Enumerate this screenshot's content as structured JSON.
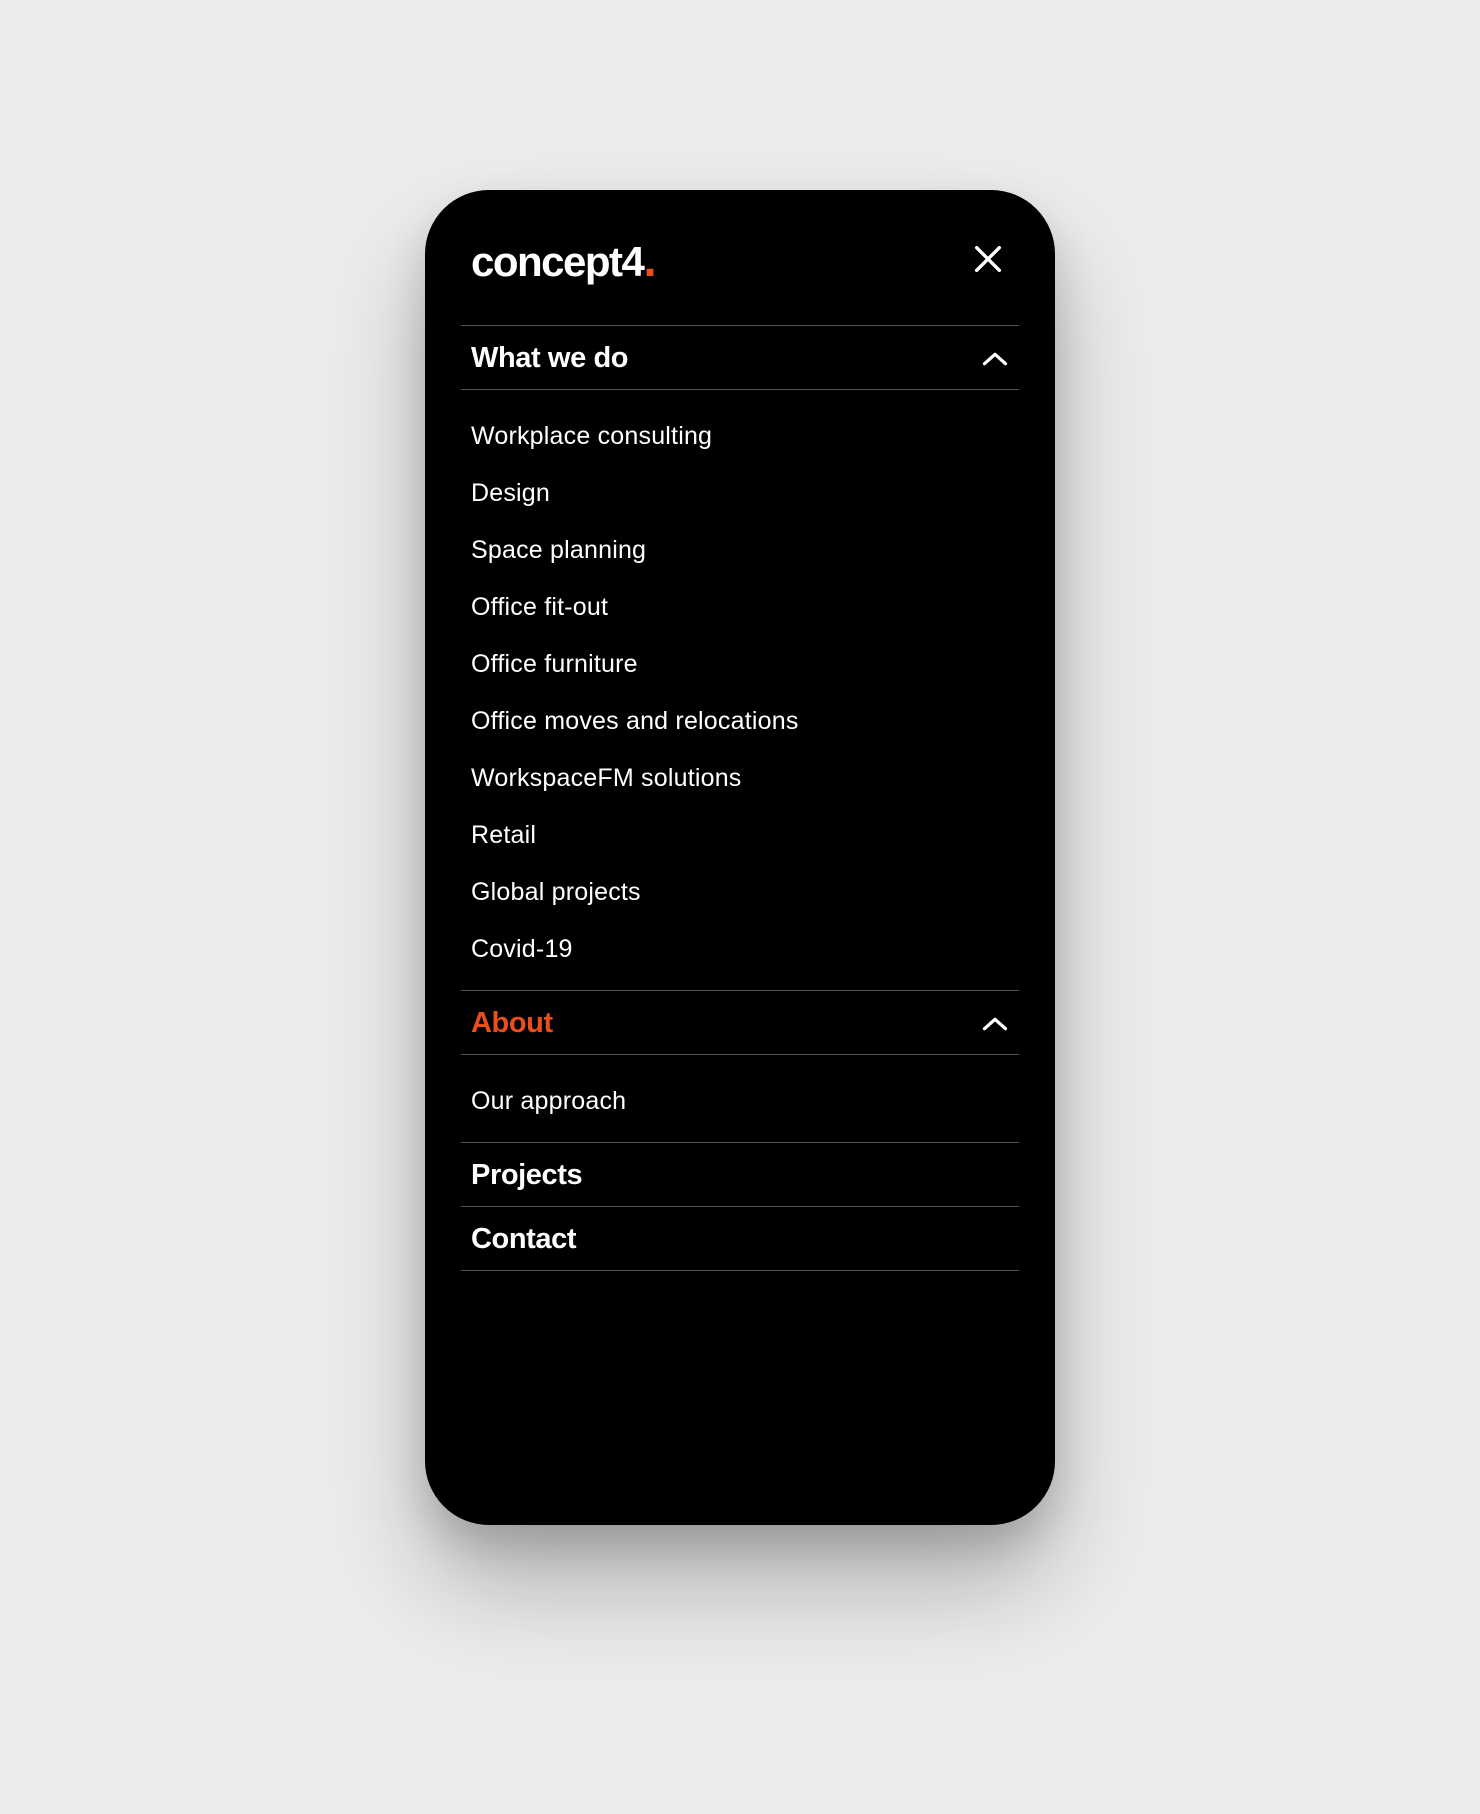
{
  "logo": {
    "text": "concept4",
    "dot": "."
  },
  "menu": {
    "sections": [
      {
        "label": "What we do",
        "expanded": true,
        "active": false,
        "items": [
          "Workplace consulting",
          "Design",
          "Space planning",
          "Office fit-out",
          "Office furniture",
          "Office moves and relocations",
          "WorkspaceFM solutions",
          "Retail",
          "Global projects",
          "Covid-19"
        ]
      },
      {
        "label": "About",
        "expanded": true,
        "active": true,
        "items": [
          "Our approach"
        ]
      },
      {
        "label": "Projects",
        "expanded": false,
        "active": false,
        "items": []
      },
      {
        "label": "Contact",
        "expanded": false,
        "active": false,
        "items": []
      }
    ]
  },
  "colors": {
    "accent": "#e94e1b",
    "bg": "#000000",
    "page_bg": "#ececec",
    "divider": "#555555",
    "text": "#ffffff"
  }
}
